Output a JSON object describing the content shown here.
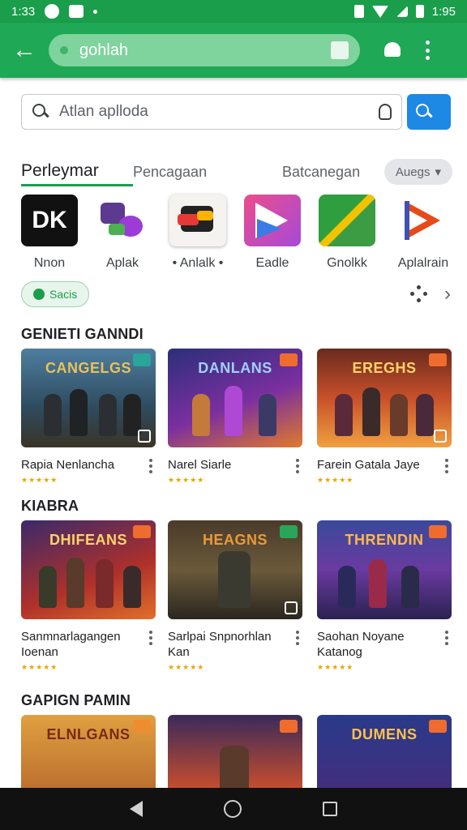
{
  "status_bar": {
    "time": "1:33",
    "battery_text": "1:95"
  },
  "app_bar": {
    "search_text": "gohlah"
  },
  "search": {
    "placeholder": "Atlan aplloda"
  },
  "tabs": [
    {
      "label": "Perleymar",
      "active": true
    },
    {
      "label": "Pencagaan",
      "active": false
    },
    {
      "label": "Batcanegan",
      "active": false
    }
  ],
  "filter_chip": {
    "label": "Auegs"
  },
  "apps": [
    {
      "label": "Nnon",
      "icon": "dk-icon",
      "icon_text": "DK"
    },
    {
      "label": "Aplak",
      "icon": "puzzle-icon"
    },
    {
      "label": "• Anlalk •",
      "icon": "chat-icon"
    },
    {
      "label": "Eadle",
      "icon": "play-icon"
    },
    {
      "label": "Gnolkk",
      "icon": "leaf-icon"
    },
    {
      "label": "Aplalrain",
      "icon": "prism-icon"
    }
  ],
  "chip": {
    "label": "Sacis"
  },
  "sections": [
    {
      "title": "GENIETI GANNDI",
      "cards": [
        {
          "thumb_title": "CANGELGS",
          "name": "Rapia Nenlancha",
          "stars": "★★★★★"
        },
        {
          "thumb_title": "DANLANS",
          "name": "Narel Siarle",
          "stars": "★★★★★"
        },
        {
          "thumb_title": "EREGHS",
          "name": "Farein Gatala Jaye",
          "stars": "★★★★★"
        }
      ]
    },
    {
      "title": "KIABRA",
      "cards": [
        {
          "thumb_title": "DHIFEANS",
          "name": "Sanmnarlagangen Ioenan",
          "stars": "★★★★★"
        },
        {
          "thumb_title": "HEAGNS",
          "name": "Sarlpai Snpnorhlan Kan",
          "stars": "★★★★★"
        },
        {
          "thumb_title": "THRENDIN",
          "name": "Saohan Noyane Katanog",
          "stars": "★★★★★"
        }
      ]
    },
    {
      "title": "GAPIGN PAMIN",
      "cards": [
        {
          "thumb_title": "ELNLGANS",
          "name": "",
          "stars": ""
        },
        {
          "thumb_title": "",
          "name": "",
          "stars": ""
        },
        {
          "thumb_title": "DUMENS",
          "name": "",
          "stars": ""
        }
      ]
    }
  ],
  "colors": {
    "app_bar": "#1fa855",
    "status_bar": "#1a9e4b",
    "search_button": "#1e88e5",
    "active_tab_underline": "#1a9e4b"
  }
}
